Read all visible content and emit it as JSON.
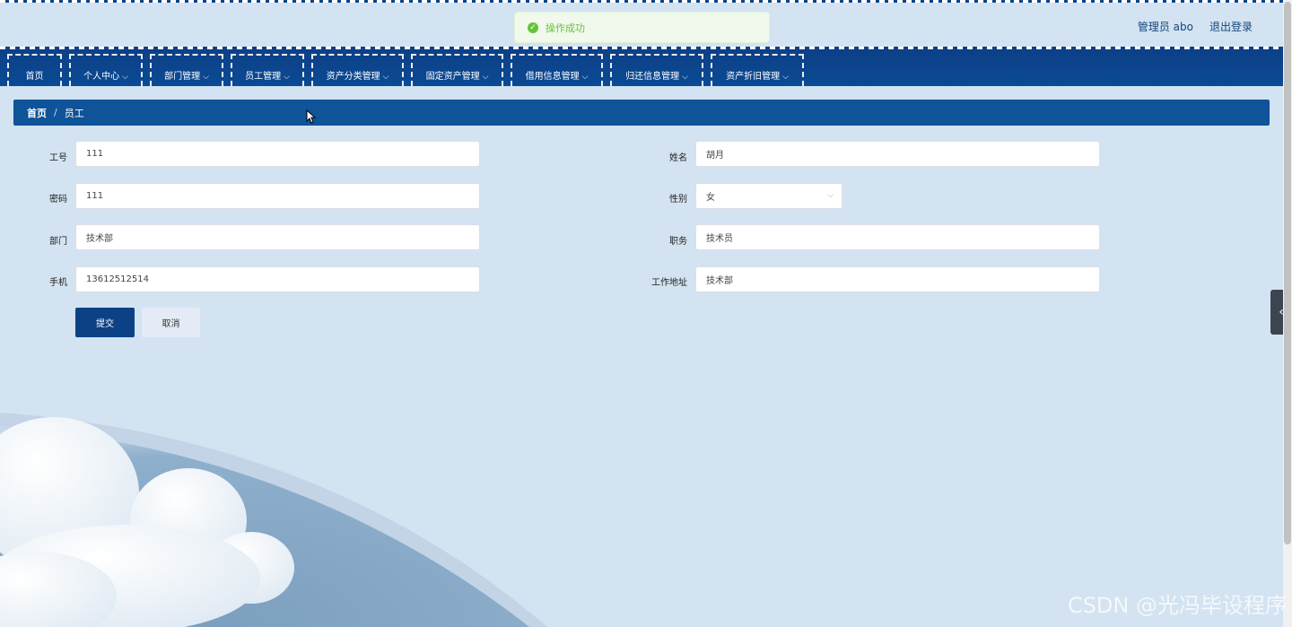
{
  "header": {
    "user_name": "管理员 abo",
    "logout_label": "退出登录"
  },
  "toast": {
    "message": "操作成功",
    "status_color": "#67c23a"
  },
  "nav": {
    "items": [
      {
        "label": "首页",
        "has_dropdown": false
      },
      {
        "label": "个人中心",
        "has_dropdown": true
      },
      {
        "label": "部门管理",
        "has_dropdown": true
      },
      {
        "label": "员工管理",
        "has_dropdown": true
      },
      {
        "label": "资产分类管理",
        "has_dropdown": true
      },
      {
        "label": "固定资产管理",
        "has_dropdown": true
      },
      {
        "label": "借用信息管理",
        "has_dropdown": true
      },
      {
        "label": "归还信息管理",
        "has_dropdown": true
      },
      {
        "label": "资产折旧管理",
        "has_dropdown": true
      }
    ]
  },
  "breadcrumb": {
    "home": "首页",
    "separator": "/",
    "current": "员工"
  },
  "form": {
    "employee_no": {
      "label": "工号",
      "value": "111"
    },
    "name": {
      "label": "姓名",
      "value": "胡月"
    },
    "password": {
      "label": "密码",
      "value": "111"
    },
    "gender": {
      "label": "性别",
      "value": "女"
    },
    "department": {
      "label": "部门",
      "value": "技术部"
    },
    "position": {
      "label": "职务",
      "value": "技术员"
    },
    "phone": {
      "label": "手机",
      "value": "13612512514"
    },
    "work_address": {
      "label": "工作地址",
      "value": "技术部"
    },
    "submit_label": "提交",
    "cancel_label": "取消"
  },
  "watermark": "CSDN @光冯毕设程序",
  "colors": {
    "primary": "#0c4185",
    "background": "#d3e3f1",
    "breadcrumb_bg": "#0f5398"
  },
  "icons": {
    "toast": "check-circle-icon",
    "dropdown": "chevron-down-icon",
    "side_toggle": "chevron-left-icon"
  }
}
